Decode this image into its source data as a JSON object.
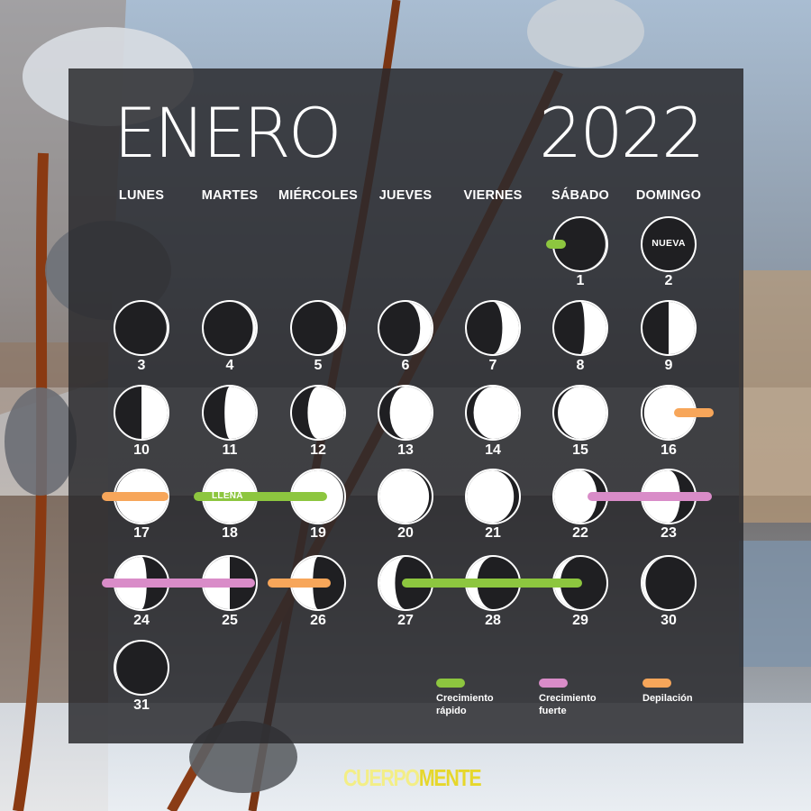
{
  "header": {
    "month": "ENERO",
    "year": "2022"
  },
  "weekdays": [
    "LUNES",
    "MARTES",
    "MIÉRCOLES",
    "JUEVES",
    "VIERNES",
    "SÁBADO",
    "DOMINGO"
  ],
  "days": [
    {
      "day": "1",
      "illumination": 0.02,
      "waxing": true
    },
    {
      "day": "2",
      "illumination": 0.0,
      "waxing": true,
      "label": "NUEVA"
    },
    {
      "day": "3",
      "illumination": 0.02,
      "waxing": true
    },
    {
      "day": "4",
      "illumination": 0.06,
      "waxing": true
    },
    {
      "day": "5",
      "illumination": 0.13,
      "waxing": true
    },
    {
      "day": "6",
      "illumination": 0.22,
      "waxing": true
    },
    {
      "day": "7",
      "illumination": 0.32,
      "waxing": true
    },
    {
      "day": "8",
      "illumination": 0.42,
      "waxing": true
    },
    {
      "day": "9",
      "illumination": 0.5,
      "waxing": true
    },
    {
      "day": "10",
      "illumination": 0.5,
      "waxing": true
    },
    {
      "day": "11",
      "illumination": 0.6,
      "waxing": true
    },
    {
      "day": "12",
      "illumination": 0.7,
      "waxing": true
    },
    {
      "day": "13",
      "illumination": 0.8,
      "waxing": true
    },
    {
      "day": "14",
      "illumination": 0.87,
      "waxing": true
    },
    {
      "day": "15",
      "illumination": 0.93,
      "waxing": true
    },
    {
      "day": "16",
      "illumination": 0.97,
      "waxing": true
    },
    {
      "day": "17",
      "illumination": 0.99,
      "waxing": true
    },
    {
      "day": "18",
      "illumination": 1.0,
      "waxing": true,
      "label": "LLENA"
    },
    {
      "day": "19",
      "illumination": 0.98,
      "waxing": false
    },
    {
      "day": "20",
      "illumination": 0.95,
      "waxing": false
    },
    {
      "day": "21",
      "illumination": 0.9,
      "waxing": false
    },
    {
      "day": "22",
      "illumination": 0.82,
      "waxing": false
    },
    {
      "day": "23",
      "illumination": 0.72,
      "waxing": false
    },
    {
      "day": "24",
      "illumination": 0.6,
      "waxing": false
    },
    {
      "day": "25",
      "illumination": 0.5,
      "waxing": false
    },
    {
      "day": "26",
      "illumination": 0.4,
      "waxing": false
    },
    {
      "day": "27",
      "illumination": 0.3,
      "waxing": false
    },
    {
      "day": "28",
      "illumination": 0.2,
      "waxing": false
    },
    {
      "day": "29",
      "illumination": 0.12,
      "waxing": false
    },
    {
      "day": "30",
      "illumination": 0.06,
      "waxing": false
    },
    {
      "day": "31",
      "illumination": 0.02,
      "waxing": false
    }
  ],
  "first_weekday": 6,
  "periods": [
    {
      "type": "rapido",
      "from": "1",
      "to": "1",
      "note": "begins before day 1"
    },
    {
      "type": "depilacion",
      "from": "16",
      "to": "16"
    },
    {
      "type": "depilacion",
      "from": "17",
      "to": "17"
    },
    {
      "type": "rapido",
      "from": "18",
      "to": "19"
    },
    {
      "type": "fuerte",
      "from": "22",
      "to": "23"
    },
    {
      "type": "fuerte",
      "from": "24",
      "to": "25"
    },
    {
      "type": "depilacion",
      "from": "26",
      "to": "26"
    },
    {
      "type": "rapido",
      "from": "27",
      "to": "29"
    }
  ],
  "legend": [
    {
      "key": "rapido",
      "label_1": "Crecimiento",
      "label_2": "rápido"
    },
    {
      "key": "fuerte",
      "label_1": "Crecimiento",
      "label_2": "fuerte"
    },
    {
      "key": "depilacion",
      "label_1": "Depilación",
      "label_2": ""
    }
  ],
  "colors": {
    "rapido": "#8dc63f",
    "fuerte": "#d98cc8",
    "depilacion": "#f7a65a",
    "moon_light": "#ffffff",
    "moon_dark": "#1f1f22"
  },
  "brand": {
    "part1": "CUERPO",
    "part2": "MENTE"
  }
}
